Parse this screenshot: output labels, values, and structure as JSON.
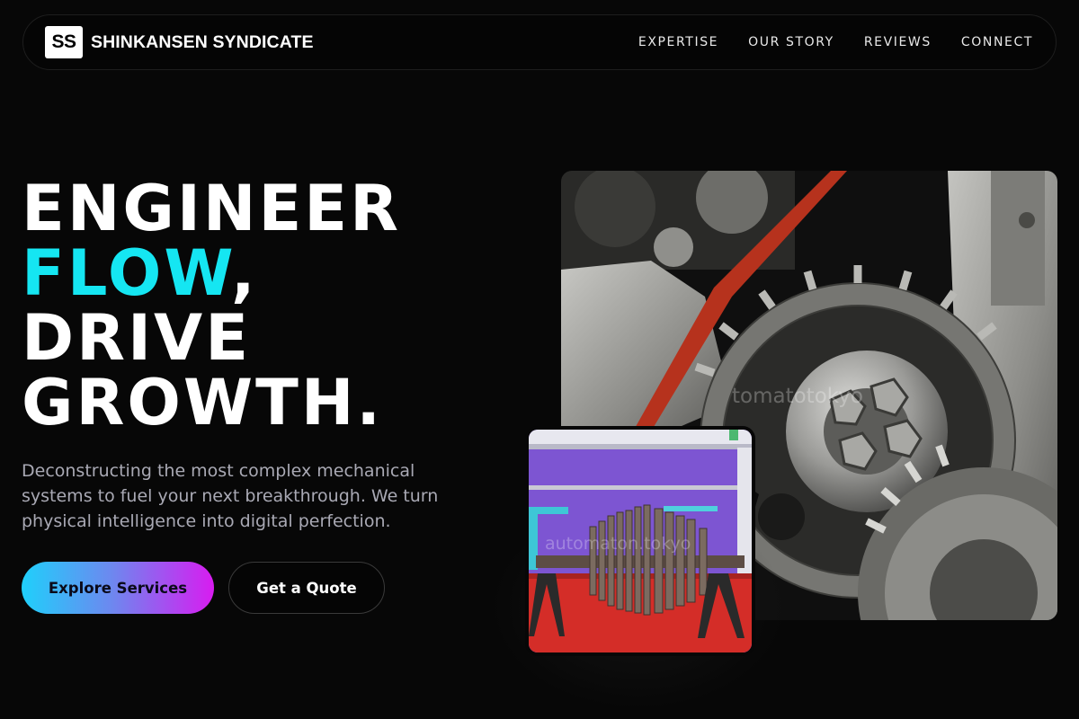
{
  "nav": {
    "logo_text": "SS",
    "brand_name": "SHINKANSEN SYNDICATE",
    "links": [
      "EXPERTISE",
      "OUR STORY",
      "REVIEWS",
      "CONNECT"
    ]
  },
  "hero": {
    "headline_line1": "ENGINEER",
    "headline_accent": "FLOW",
    "headline_comma": ",",
    "headline_line3": "DRIVE",
    "headline_line4": "GROWTH.",
    "subtitle": "Deconstructing the most complex mechanical systems to fuel your next breakthrough. We turn physical intelligence into digital perfection.",
    "primary_button": "Explore Services",
    "secondary_button": "Get a Quote"
  },
  "images": {
    "main_watermark": "tomatotokyo",
    "small_watermark": "automaton.tokyo"
  },
  "colors": {
    "background": "#070707",
    "accent": "#15e6f2",
    "gradient_start": "#1fd0fb",
    "gradient_end": "#d81cf0",
    "subtitle_text": "#a9a9b4"
  }
}
